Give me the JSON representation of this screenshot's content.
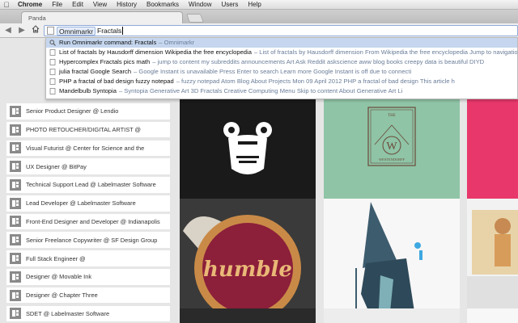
{
  "menubar": {
    "apple": "",
    "items": [
      "Chrome",
      "File",
      "Edit",
      "View",
      "History",
      "Bookmarks",
      "Window",
      "Users",
      "Help"
    ]
  },
  "tab": {
    "title": "Panda"
  },
  "omnibox": {
    "keyword": "Omnimarkr",
    "query": "Fractals"
  },
  "suggestions": [
    {
      "title": "Run Omnimarkr command: Fractals",
      "url": "Omnimarkr",
      "selected": true,
      "icon": "search-icon"
    },
    {
      "title": "List of fractals by Hausdorff dimension Wikipedia the free encyclopedia",
      "url": "List of fractals by Hausdorff dimension From Wikipedia the free encyclopedia Jump to navigation",
      "selected": false,
      "icon": "page-icon"
    },
    {
      "title": "Hypercomplex Fractals pics math",
      "url": "jump to content my subreddits announcements Art Ask Reddit askscience aww blog books creepy data is beautiful DIYD",
      "selected": false,
      "icon": "page-icon"
    },
    {
      "title": "julia fractal Google Search",
      "url": "Google Instant is unavailable Press Enter to search Learn more Google Instant is off due to connecti",
      "selected": false,
      "icon": "page-icon"
    },
    {
      "title": "PHP a fractal of bad design fuzzy notepad",
      "url": "fuzzy notepad Atom Blog About Projects Mon 09 April 2012 PHP a fractal of bad design This article h",
      "selected": false,
      "icon": "page-icon"
    },
    {
      "title": "Mandelbulb Syntopia",
      "url": "Syntopia Generative Art 3D Fractals Creative Computing Menu Skip to content About Generative Art Li",
      "selected": false,
      "icon": "page-icon"
    }
  ],
  "jobs": [
    "Senior Product Designer @ Lendio",
    "PHOTO RETOUCHER/DIGITAL ARTIST @",
    "Visual Futurist @ Center for Science and the",
    "UX Designer @ BitPay",
    "Technical Support Lead @ Labelmaster Software",
    "Lead Developer @ Labelmaster Software",
    "Front-End Designer and Developer @ Indianapolis",
    "Senior Freelance Copywriter @ SF Design Group",
    "Full Stack Engineer @",
    "Designer @ Movable Ink",
    "Designer @ Chapter Three",
    "SDET @ Labelmaster Software"
  ],
  "shots": {
    "westendorff_top": "THE",
    "westendorff_letter": "W",
    "westendorff_bottom": "WESTENDORFF",
    "humble_word": "humble"
  },
  "colors": {
    "robot_bg": "#1a1a1a",
    "westendorff_bg": "#8fc4a6",
    "westendorff_ink": "#6b4a3a",
    "pink": "#e8386b",
    "pie_crust": "#d9a15b",
    "selection": "#c5d6ee"
  }
}
